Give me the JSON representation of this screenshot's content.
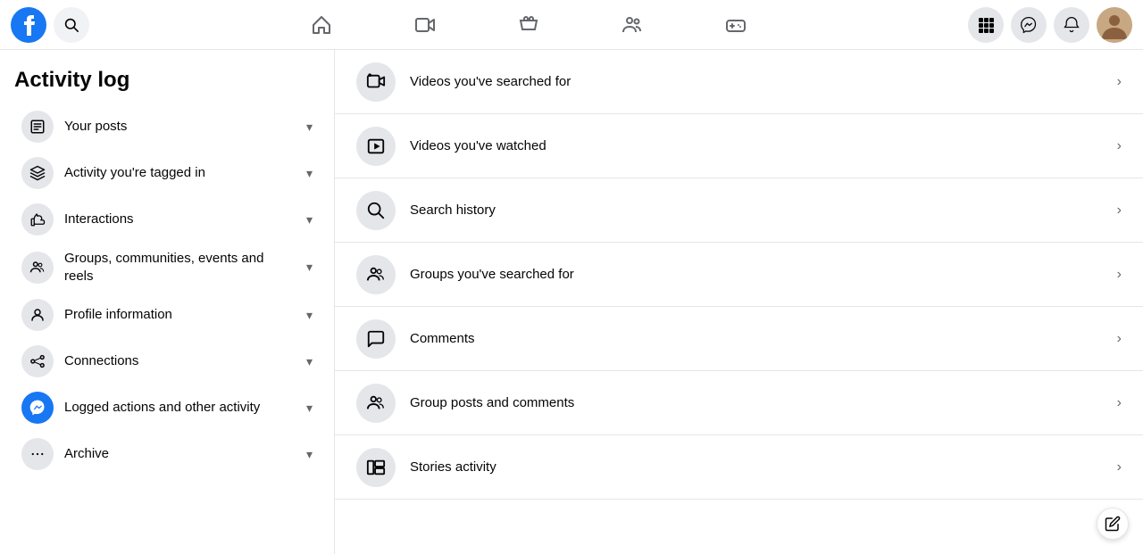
{
  "topnav": {
    "logo_alt": "Facebook",
    "nav_icons": [
      {
        "id": "home",
        "label": "Home",
        "icon": "⌂",
        "active": false
      },
      {
        "id": "video",
        "label": "Video",
        "icon": "▶",
        "active": false
      },
      {
        "id": "marketplace",
        "label": "Marketplace",
        "icon": "🏪",
        "active": false
      },
      {
        "id": "groups",
        "label": "Groups",
        "icon": "👥",
        "active": false
      },
      {
        "id": "gaming",
        "label": "Gaming",
        "icon": "🎮",
        "active": false
      }
    ],
    "right_buttons": [
      {
        "id": "apps",
        "icon": "⊞",
        "label": "Apps"
      },
      {
        "id": "messenger",
        "icon": "💬",
        "label": "Messenger"
      },
      {
        "id": "notifications",
        "icon": "🔔",
        "label": "Notifications"
      }
    ]
  },
  "sidebar": {
    "title": "Activity log",
    "items": [
      {
        "id": "your-posts",
        "label": "Your posts",
        "icon": "📝"
      },
      {
        "id": "activity-tagged",
        "label": "Activity you're tagged in",
        "icon": "🏷"
      },
      {
        "id": "interactions",
        "label": "Interactions",
        "icon": "👍"
      },
      {
        "id": "groups",
        "label": "Groups, communities, events and reels",
        "icon": "👥"
      },
      {
        "id": "profile-info",
        "label": "Profile information",
        "icon": "👤"
      },
      {
        "id": "connections",
        "label": "Connections",
        "icon": "🔗"
      },
      {
        "id": "logged-actions",
        "label": "Logged actions and other activity",
        "icon": "🟦"
      },
      {
        "id": "archive",
        "label": "Archive",
        "icon": "•••"
      }
    ]
  },
  "main": {
    "items": [
      {
        "id": "videos-searched",
        "label": "Videos you've searched for",
        "icon": "🎬"
      },
      {
        "id": "videos-watched",
        "label": "Videos you've watched",
        "icon": "▶"
      },
      {
        "id": "search-history",
        "label": "Search history",
        "icon": "🔍"
      },
      {
        "id": "groups-searched",
        "label": "Groups you've searched for",
        "icon": "👥"
      },
      {
        "id": "comments",
        "label": "Comments",
        "icon": "💬"
      },
      {
        "id": "group-posts",
        "label": "Group posts and comments",
        "icon": "👥"
      },
      {
        "id": "stories-activity",
        "label": "Stories activity",
        "icon": "🎞"
      }
    ]
  },
  "float_button": {
    "label": "Edit",
    "icon": "✏"
  }
}
